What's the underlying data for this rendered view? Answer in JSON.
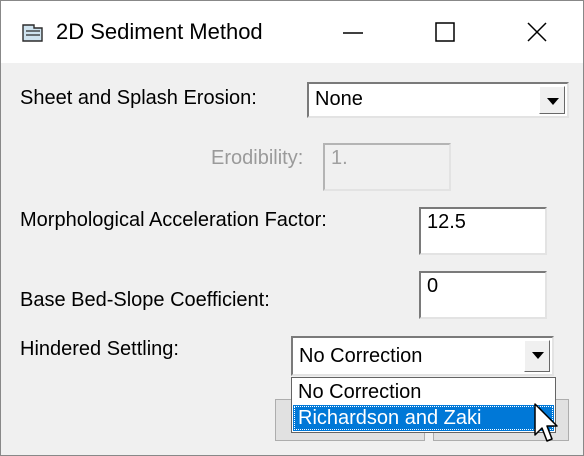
{
  "window": {
    "title": "2D Sediment Method"
  },
  "sheet_splash": {
    "label": "Sheet and Splash Erosion:",
    "value": "None"
  },
  "erodibility": {
    "label": "Erodibility:",
    "value": "1."
  },
  "morph_accel": {
    "label": "Morphological Acceleration Factor:",
    "value": "12.5"
  },
  "bed_slope": {
    "label": "Base Bed-Slope Coefficient:",
    "value": "0"
  },
  "hindered": {
    "label": "Hindered Settling:",
    "value": "No Correction",
    "options": [
      "No Correction",
      "Richardson and Zaki"
    ],
    "highlighted": "Richardson and Zaki"
  },
  "colors": {
    "highlight": "#0078d7",
    "titlebar": "#ffffff",
    "face": "#f0f0f0"
  }
}
